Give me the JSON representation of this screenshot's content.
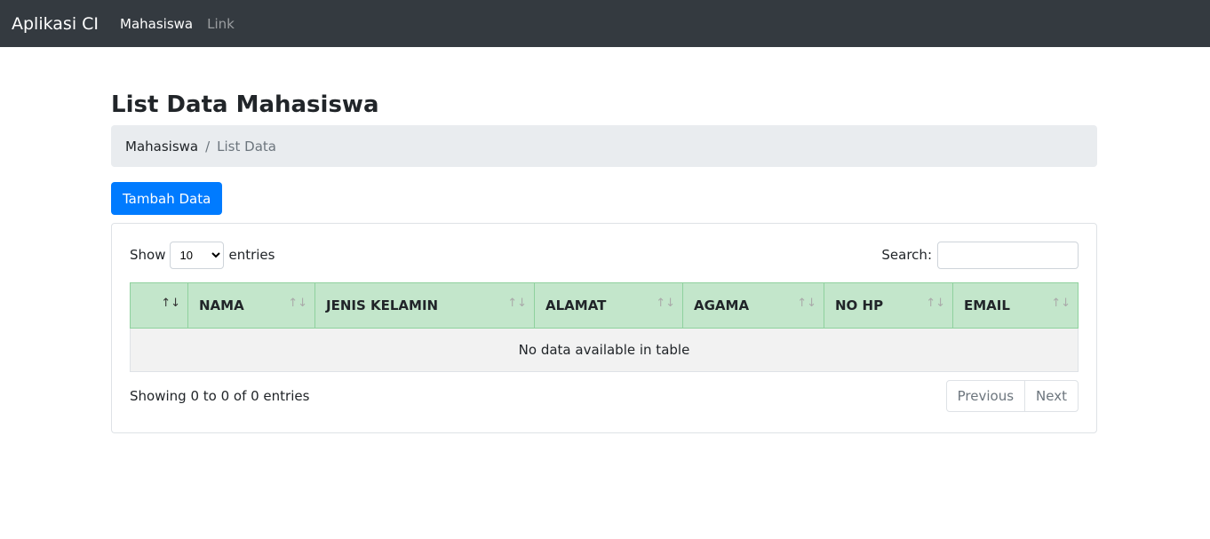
{
  "navbar": {
    "brand": "Aplikasi CI",
    "items": [
      "Mahasiswa",
      "Link"
    ]
  },
  "page": {
    "title": "List Data Mahasiswa",
    "breadcrumb": [
      "Mahasiswa",
      "List Data"
    ],
    "separator": "/",
    "add_button": "Tambah Data"
  },
  "table": {
    "show_label": "Show",
    "entries_label": "entries",
    "length_value": "10",
    "search_label": "Search:",
    "search_value": "",
    "columns": [
      "",
      "NAMA",
      "JENIS KELAMIN",
      "ALAMAT",
      "AGAMA",
      "NO HP",
      "EMAIL"
    ],
    "sort_icon": "↑↓",
    "empty_message": "No data available in table",
    "info": "Showing 0 to 0 of 0 entries",
    "prev": "Previous",
    "next": "Next"
  }
}
